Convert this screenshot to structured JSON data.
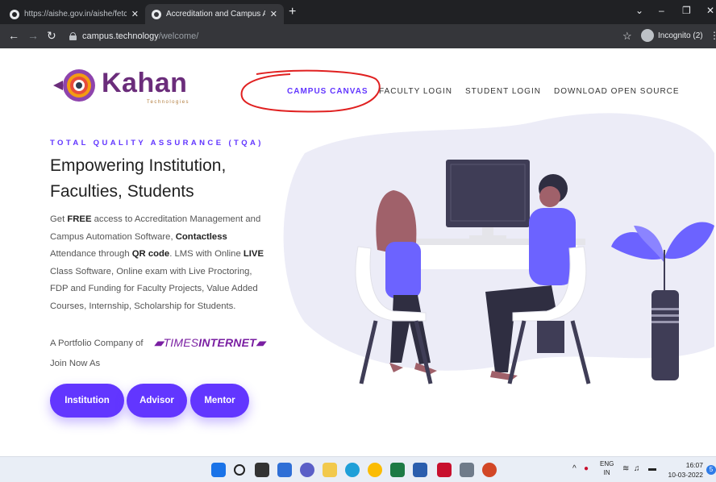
{
  "browser": {
    "tabs": [
      {
        "title": "https://aishe.gov.in/aishe/fetchSi",
        "active": false
      },
      {
        "title": "Accreditation and Campus Autom",
        "active": true
      }
    ],
    "new_tab": "+",
    "address": {
      "host": "campus.technology",
      "path": "/welcome/"
    },
    "profile_label": "Incognito (2)"
  },
  "site": {
    "logo": {
      "name": "Kahan",
      "tagline": "Technologies"
    },
    "nav": [
      {
        "label": "CAMPUS CANVAS",
        "active": true
      },
      {
        "label": "FACULTY LOGIN",
        "active": false
      },
      {
        "label": "STUDENT LOGIN",
        "active": false
      },
      {
        "label": "DOWNLOAD OPEN SOURCE",
        "active": false
      }
    ],
    "hero": {
      "eyebrow": "TOTAL QUALITY ASSURANCE (TQA)",
      "title_line1": "Empowering Institution,",
      "title_line2": "Faculties, Students",
      "desc": {
        "p1": "Get ",
        "b1": "FREE",
        "p2": " access to Accreditation Management and Campus Automation Software, ",
        "b2": "Contactless",
        "p3": " Attendance through ",
        "b3": "QR code",
        "p4": ". LMS with Online ",
        "b4": "LIVE",
        "p5": " Class Software, Online exam with Live Proctoring, FDP and Funding for Faculty Projects, Value Added Courses, Internship, Scholarship for Students."
      },
      "portfolio_text": "A Portfolio Company of",
      "times_brand_a": "TIMES",
      "times_brand_b": "INTERNET",
      "join_text": "Join Now As",
      "buttons": [
        "Institution",
        "Advisor",
        "Mentor"
      ]
    }
  },
  "taskbar": {
    "lang_top": "ENG",
    "lang_bottom": "IN",
    "time": "16:07",
    "date": "10-03-2022",
    "notifications": "5"
  },
  "colors": {
    "accent": "#6236ff",
    "brand": "#6b2d7b",
    "annotation": "#e02020"
  }
}
